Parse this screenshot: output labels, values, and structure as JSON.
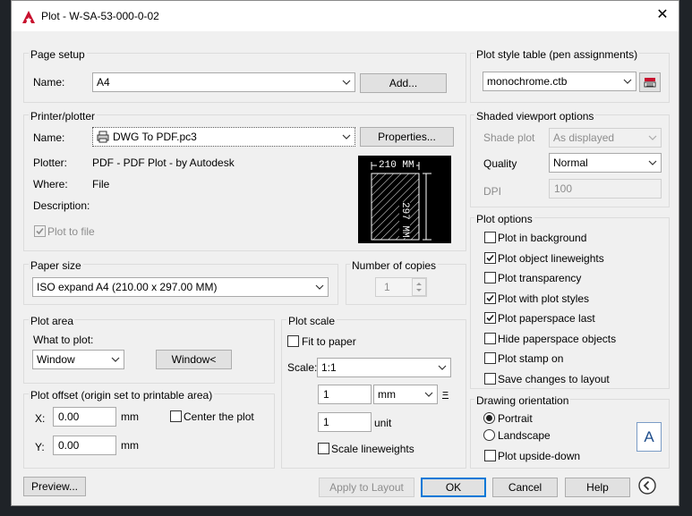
{
  "window": {
    "title": "Plot - W-SA-53-000-0-02",
    "close": "✕"
  },
  "page_setup": {
    "title": "Page setup",
    "name_label": "Name:",
    "name_value": "A4",
    "add_button": "Add..."
  },
  "printer": {
    "title": "Printer/plotter",
    "name_label": "Name:",
    "name_value": "DWG To PDF.pc3",
    "properties_button": "Properties...",
    "plotter_label": "Plotter:",
    "plotter_value": "PDF - PDF Plot - by Autodesk",
    "where_label": "Where:",
    "where_value": "File",
    "description_label": "Description:",
    "plot_to_file_label": "Plot to file",
    "plot_to_file_checked": true,
    "preview_width": "210 MM",
    "preview_height": "297 MM"
  },
  "paper_size": {
    "title": "Paper size",
    "value": "ISO expand A4 (210.00 x 297.00 MM)"
  },
  "copies": {
    "title": "Number of copies",
    "value": "1"
  },
  "plot_area": {
    "title": "Plot area",
    "what_label": "What to plot:",
    "what_value": "Window",
    "window_button": "Window<"
  },
  "plot_offset": {
    "title": "Plot offset (origin set to printable area)",
    "x_label": "X:",
    "x_value": "0.00",
    "y_label": "Y:",
    "y_value": "0.00",
    "unit": "mm",
    "center_label": "Center the plot",
    "center_checked": false
  },
  "plot_scale": {
    "title": "Plot scale",
    "fit_label": "Fit to paper",
    "fit_checked": false,
    "scale_label": "Scale:",
    "scale_value": "1:1",
    "value1": "1",
    "unit1": "mm",
    "equals": "=",
    "value2": "1",
    "unit2": "unit",
    "lineweights_label": "Scale lineweights",
    "lineweights_checked": false
  },
  "style_table": {
    "title": "Plot style table (pen assignments)",
    "value": "monochrome.ctb",
    "edit_icon": "plot-style-edit-icon"
  },
  "shaded": {
    "title": "Shaded viewport options",
    "shade_label": "Shade plot",
    "shade_value": "As displayed",
    "quality_label": "Quality",
    "quality_value": "Normal",
    "dpi_label": "DPI",
    "dpi_value": "100"
  },
  "plot_options": {
    "title": "Plot options",
    "items": [
      {
        "label": "Plot in background",
        "checked": false
      },
      {
        "label": "Plot object lineweights",
        "checked": true
      },
      {
        "label": "Plot transparency",
        "checked": false
      },
      {
        "label": "Plot with plot styles",
        "checked": true
      },
      {
        "label": "Plot paperspace last",
        "checked": true
      },
      {
        "label": "Hide paperspace objects",
        "checked": false
      },
      {
        "label": "Plot stamp on",
        "checked": false
      },
      {
        "label": "Save changes to layout",
        "checked": false
      }
    ]
  },
  "orientation": {
    "title": "Drawing orientation",
    "portrait_label": "Portrait",
    "landscape_label": "Landscape",
    "selected": "Portrait",
    "upside_label": "Plot upside-down",
    "upside_checked": false,
    "icon_letter": "A"
  },
  "footer": {
    "preview": "Preview...",
    "apply": "Apply to Layout",
    "ok": "OK",
    "cancel": "Cancel",
    "help": "Help",
    "collapse_icon": "chevron-left-circle-icon"
  }
}
